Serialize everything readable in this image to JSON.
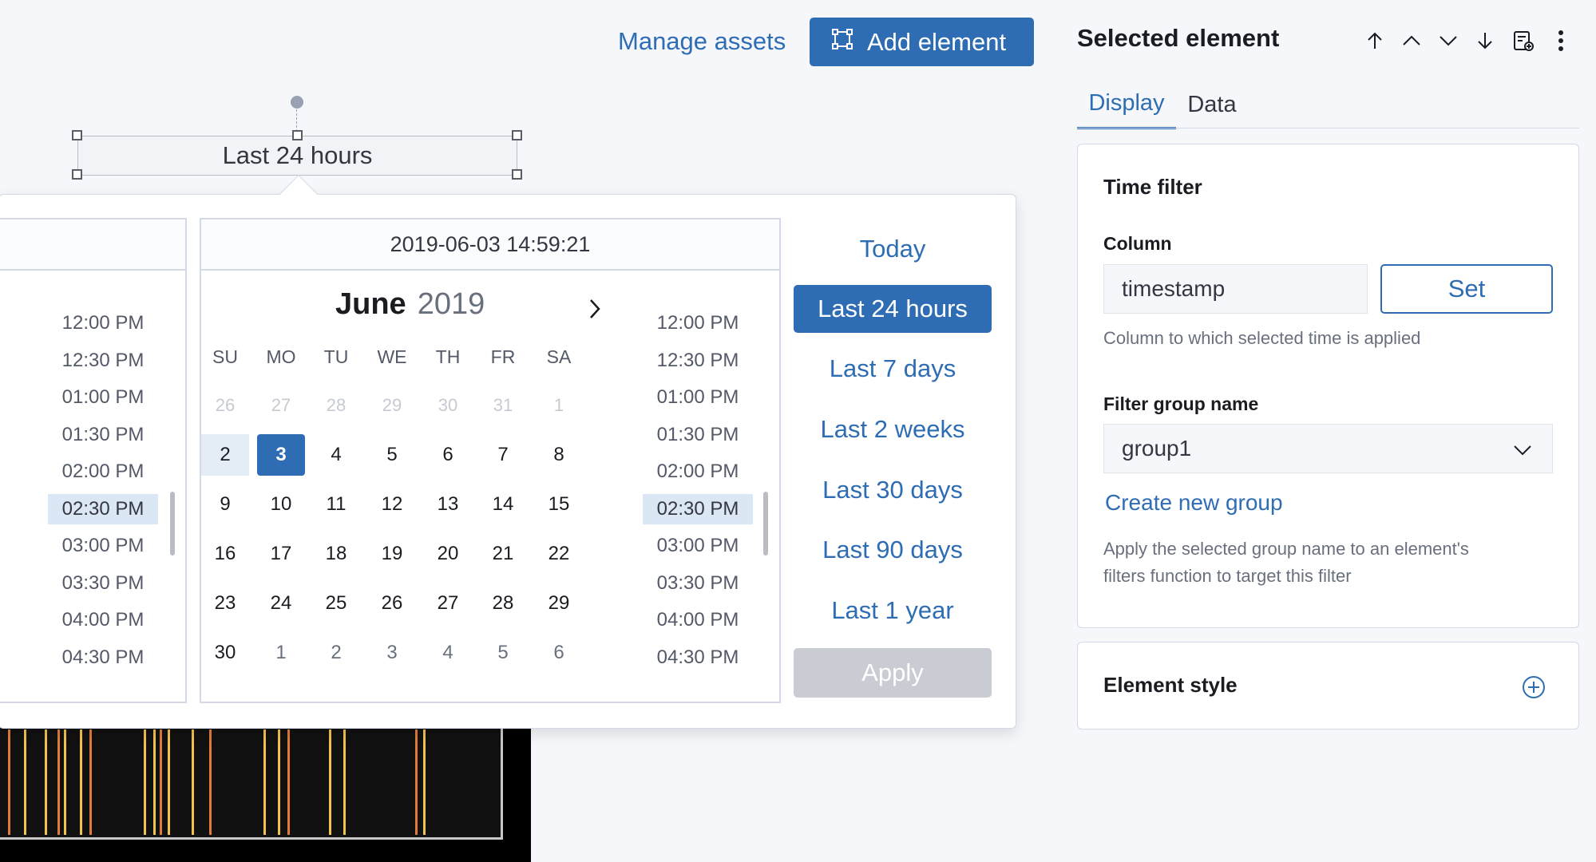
{
  "header": {
    "manage_assets": "Manage assets",
    "add_element": "Add element"
  },
  "element": {
    "label": "Last 24 hours"
  },
  "picker": {
    "date_value": "2019-06-03 14:59:21",
    "month": "June",
    "year": "2019",
    "weekdays": [
      "SU",
      "MO",
      "TU",
      "WE",
      "TH",
      "FR",
      "SA"
    ],
    "weeks": [
      [
        "26",
        "27",
        "28",
        "29",
        "30",
        "31",
        "1"
      ],
      [
        "2",
        "3",
        "4",
        "5",
        "6",
        "7",
        "8"
      ],
      [
        "9",
        "10",
        "11",
        "12",
        "13",
        "14",
        "15"
      ],
      [
        "16",
        "17",
        "18",
        "19",
        "20",
        "21",
        "22"
      ],
      [
        "23",
        "24",
        "25",
        "26",
        "27",
        "28",
        "29"
      ],
      [
        "30",
        "1",
        "2",
        "3",
        "4",
        "5",
        "6"
      ]
    ],
    "selected_day": "3",
    "range_start_day": "2",
    "left_times": [
      "12:00 PM",
      "12:30 PM",
      "01:00 PM",
      "01:30 PM",
      "02:00 PM",
      "02:30 PM",
      "03:00 PM",
      "03:30 PM",
      "04:00 PM",
      "04:30 PM"
    ],
    "right_times": [
      "12:00 PM",
      "12:30 PM",
      "01:00 PM",
      "01:30 PM",
      "02:00 PM",
      "02:30 PM",
      "03:00 PM",
      "03:30 PM",
      "04:00 PM",
      "04:30 PM"
    ],
    "selected_time": "02:30 PM",
    "quick_ranges": [
      "Today",
      "Last 24 hours",
      "Last 7 days",
      "Last 2 weeks",
      "Last 30 days",
      "Last 90 days",
      "Last 1 year"
    ],
    "active_quick_range": "Last 24 hours",
    "apply_label": "Apply"
  },
  "sidebar": {
    "title": "Selected element",
    "tabs": {
      "display": "Display",
      "data": "Data"
    },
    "time_filter": {
      "heading": "Time filter",
      "column_label": "Column",
      "column_value": "timestamp",
      "set_label": "Set",
      "column_help": "Column to which selected time is applied",
      "group_label": "Filter group name",
      "group_value": "group1",
      "create_group": "Create new group",
      "group_help_1": "Apply the selected group name to an element's",
      "group_help_2": "filters function to target this filter"
    },
    "element_style": {
      "heading": "Element style"
    }
  },
  "colors": {
    "accent": "#2e6db4",
    "range_highlight": "#e4ecf6",
    "apply_disabled": "#c9ccd2",
    "stripe_yellow": "#f2c14e",
    "stripe_orange": "#e07b39"
  },
  "icons": [
    "add-element-icon",
    "move-up-icon",
    "chevron-up-icon",
    "chevron-down-icon",
    "move-down-icon",
    "save-element-icon",
    "more-vertical-icon",
    "chevron-right-icon",
    "plus-circle-icon"
  ]
}
